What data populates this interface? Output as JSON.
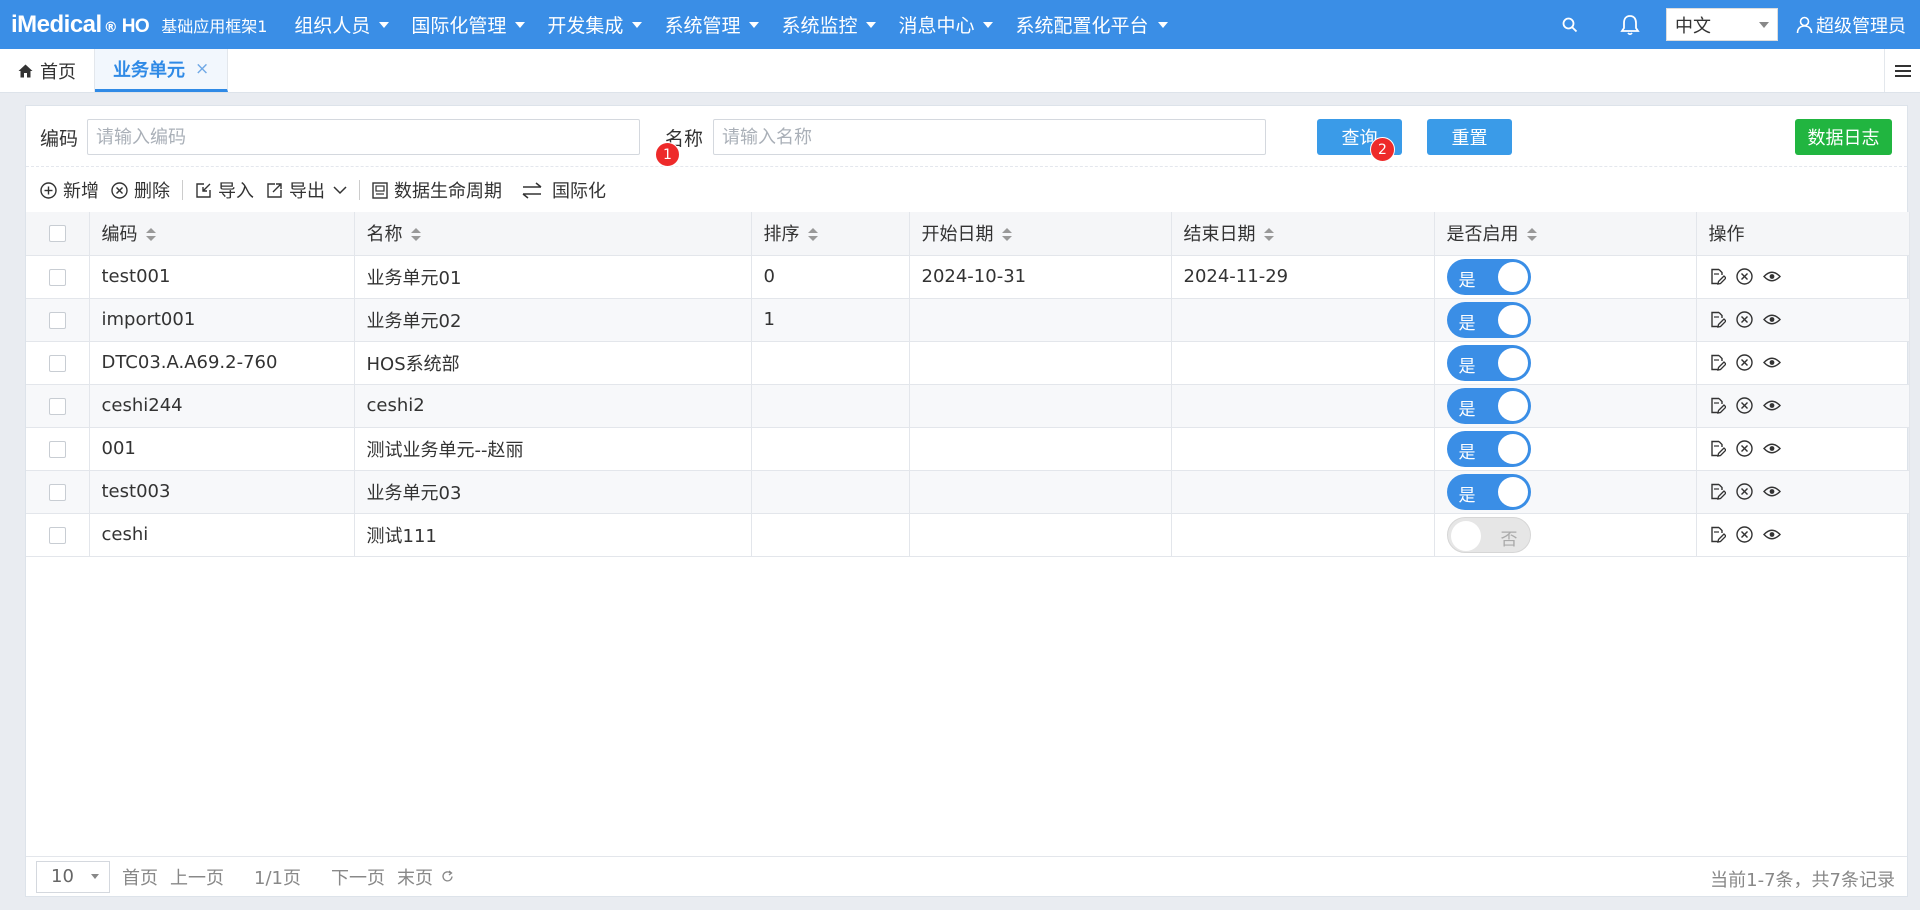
{
  "header": {
    "logo": "iMedical",
    "logo_mark": "®",
    "logo_suffix": "HO",
    "subtitle": "基础应用框架1",
    "menus": [
      "组织人员",
      "国际化管理",
      "开发集成",
      "系统管理",
      "系统监控",
      "消息中心",
      "系统配置化平台"
    ],
    "language": "中文",
    "user": "超级管理员"
  },
  "tabs": {
    "home": "首页",
    "active": "业务单元",
    "close": "×"
  },
  "search": {
    "code_label": "编码",
    "code_placeholder": "请输入编码",
    "name_label": "名称",
    "name_placeholder": "请输入名称",
    "query_button": "查询",
    "reset_button": "重置",
    "log_button": "数据日志",
    "badge1": "1",
    "badge2": "2"
  },
  "toolbar": {
    "add": "新增",
    "delete": "删除",
    "import": "导入",
    "export": "导出",
    "lifecycle": "数据生命周期",
    "i18n": "国际化"
  },
  "table": {
    "columns": [
      "编码",
      "名称",
      "排序",
      "开始日期",
      "结束日期",
      "是否启用",
      "操作"
    ],
    "rows": [
      {
        "code": "test001",
        "name": "业务单元01",
        "sort": "0",
        "start": "2024-10-31",
        "end": "2024-11-29",
        "enabled": "是"
      },
      {
        "code": "import001",
        "name": "业务单元02",
        "sort": "1",
        "start": "",
        "end": "",
        "enabled": "是"
      },
      {
        "code": "DTC03.A.A69.2-760",
        "name": "HOS系统部",
        "sort": "",
        "start": "",
        "end": "",
        "enabled": "是"
      },
      {
        "code": "ceshi244",
        "name": "ceshi2",
        "sort": "",
        "start": "",
        "end": "",
        "enabled": "是"
      },
      {
        "code": "001",
        "name": "测试业务单元--赵丽",
        "sort": "",
        "start": "",
        "end": "",
        "enabled": "是"
      },
      {
        "code": "test003",
        "name": "业务单元03",
        "sort": "",
        "start": "",
        "end": "",
        "enabled": "是"
      },
      {
        "code": "ceshi",
        "name": "测试111",
        "sort": "",
        "start": "",
        "end": "",
        "enabled": "否"
      }
    ]
  },
  "pager": {
    "page_size": "10",
    "first": "首页",
    "prev": "上一页",
    "current": "1/1页",
    "next": "下一页",
    "last": "末页",
    "summary": "当前1-7条，共7条记录"
  },
  "colors": {
    "primary": "#3a8ee6",
    "success": "#21b540",
    "badge": "#ee2a2a"
  }
}
